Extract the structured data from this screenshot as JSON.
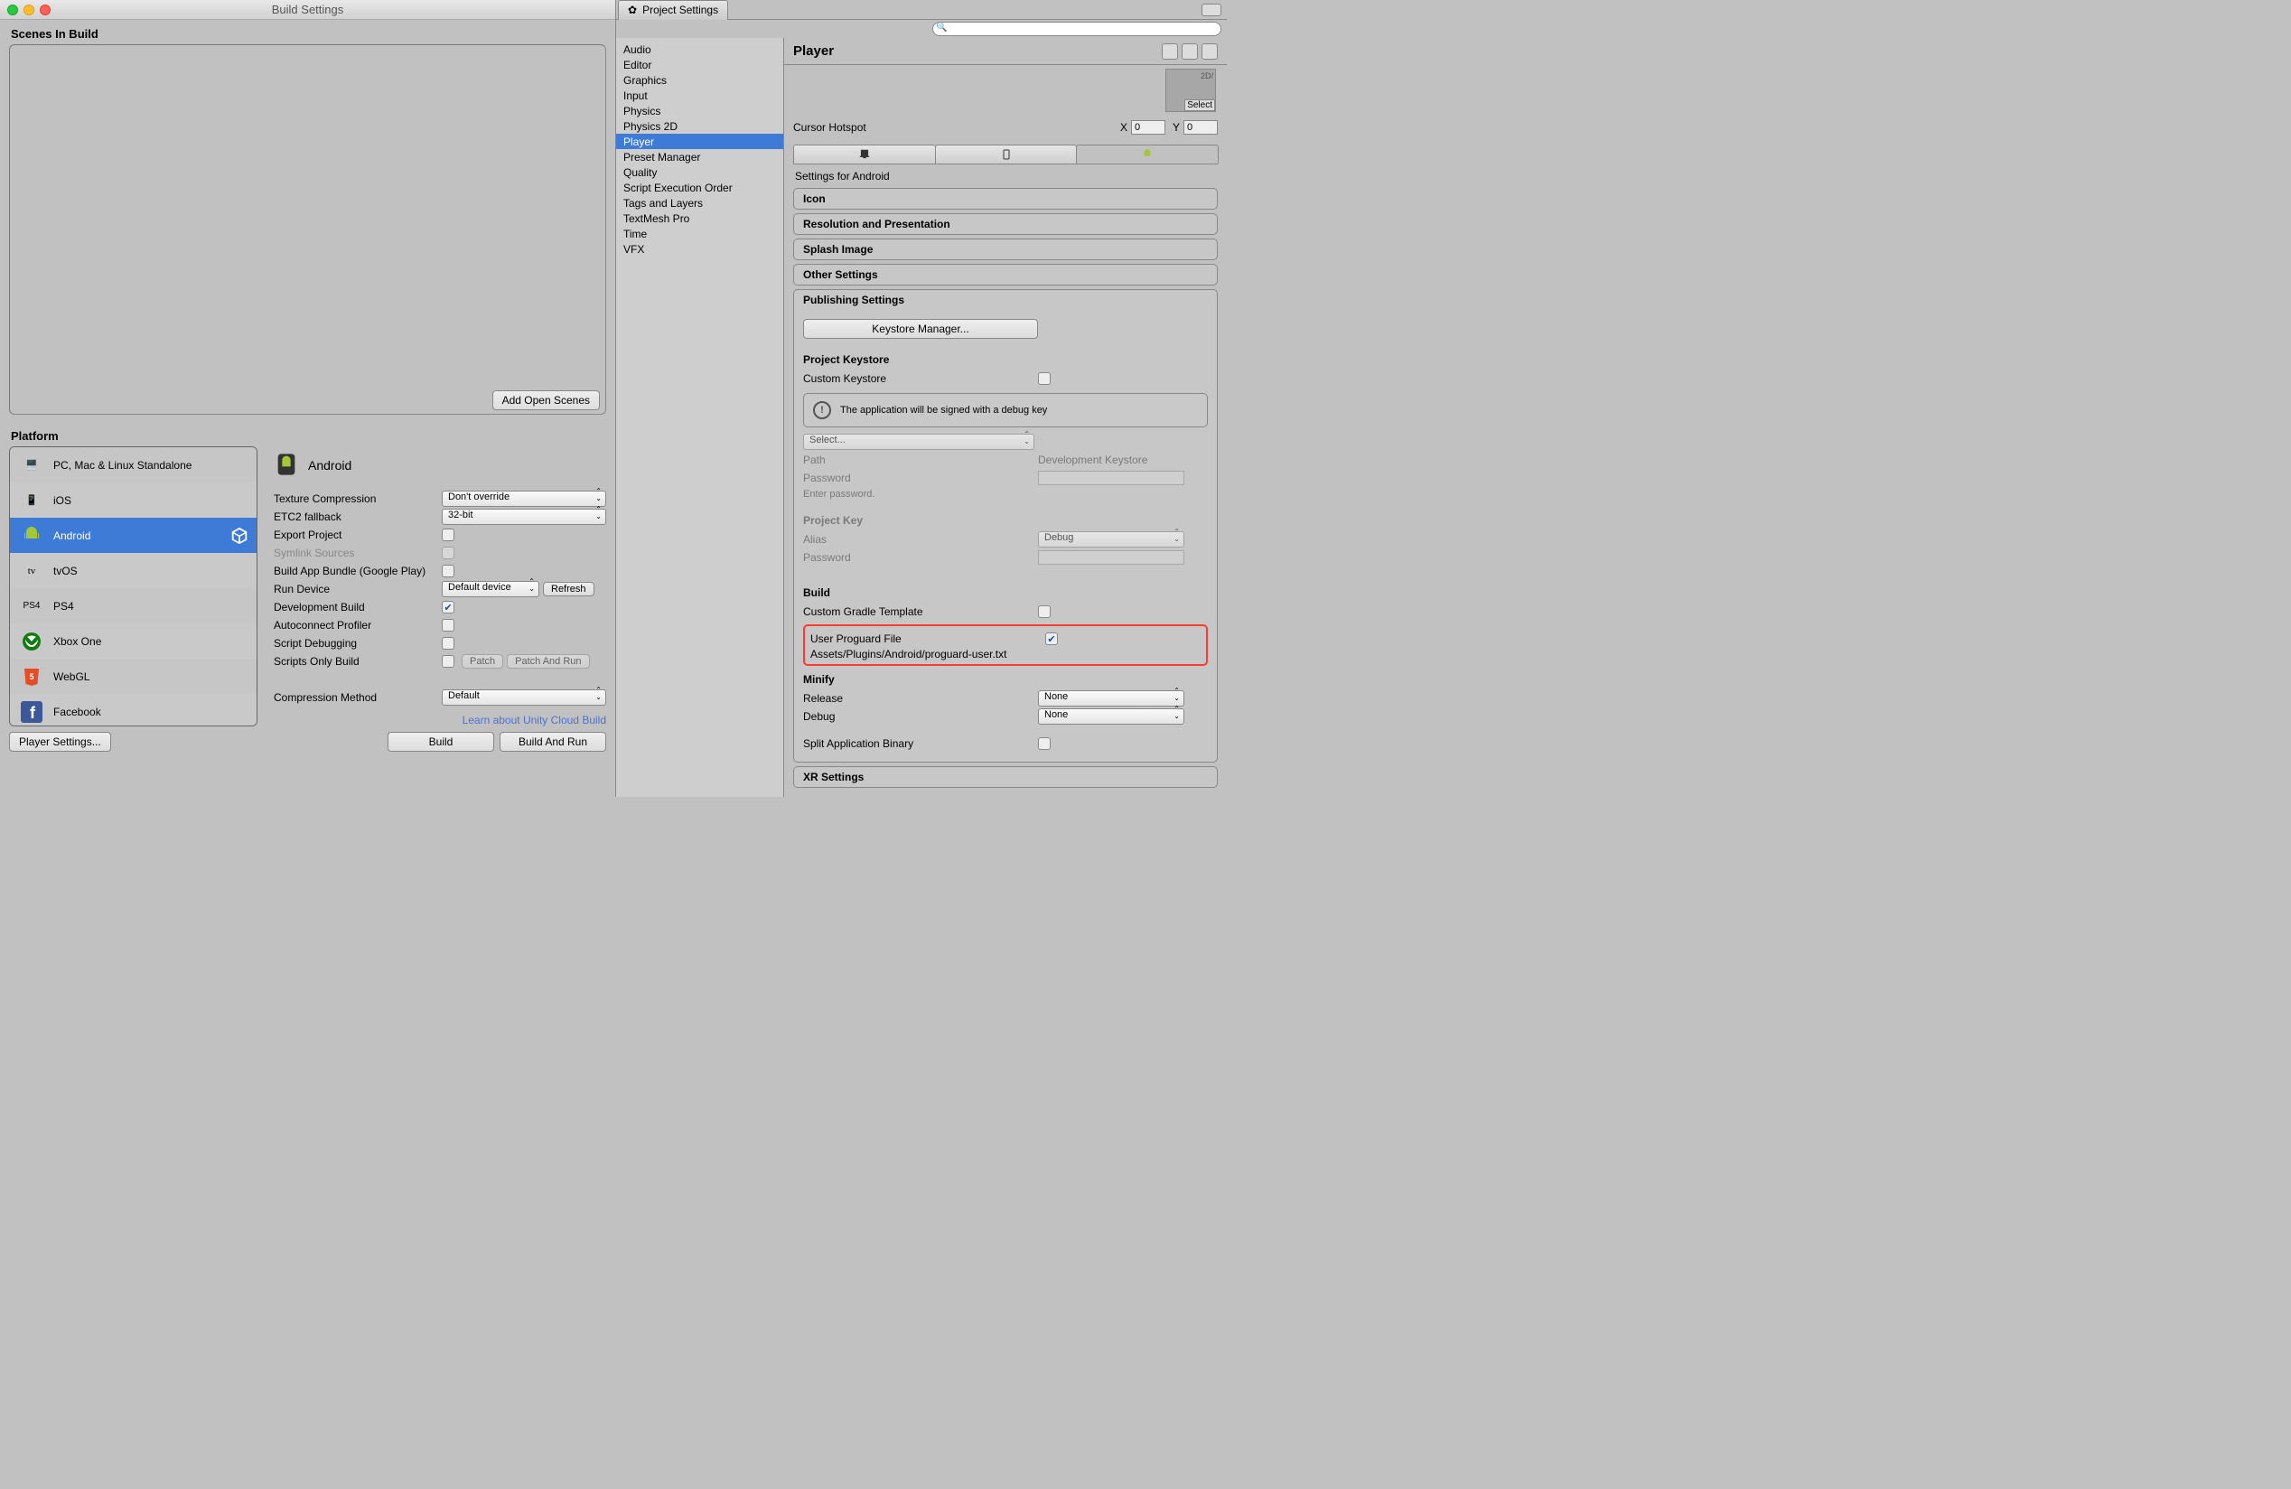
{
  "buildWindow": {
    "title": "Build Settings",
    "scenesLabel": "Scenes In Build",
    "addOpenScenes": "Add Open Scenes",
    "platformLabel": "Platform",
    "platforms": [
      "PC, Mac & Linux Standalone",
      "iOS",
      "Android",
      "tvOS",
      "PS4",
      "Xbox One",
      "WebGL",
      "Facebook"
    ],
    "selectedPlatform": "Android",
    "options": {
      "textureCompression": {
        "label": "Texture Compression",
        "value": "Don't override"
      },
      "etc2": {
        "label": "ETC2 fallback",
        "value": "32-bit"
      },
      "exportProject": "Export Project",
      "symlink": "Symlink Sources",
      "bundle": "Build App Bundle (Google Play)",
      "runDevice": {
        "label": "Run Device",
        "value": "Default device",
        "refresh": "Refresh"
      },
      "devBuild": "Development Build",
      "autoconnect": "Autoconnect Profiler",
      "scriptDebug": "Script Debugging",
      "scriptsOnly": "Scripts Only Build",
      "patch": "Patch",
      "patchRun": "Patch And Run",
      "compressionMethod": {
        "label": "Compression Method",
        "value": "Default"
      }
    },
    "cloudLink": "Learn about Unity Cloud Build",
    "playerSettingsBtn": "Player Settings...",
    "build": "Build",
    "buildRun": "Build And Run"
  },
  "ps": {
    "tabTitle": "Project Settings",
    "categories": [
      "Audio",
      "Editor",
      "Graphics",
      "Input",
      "Physics",
      "Physics 2D",
      "Player",
      "Preset Manager",
      "Quality",
      "Script Execution Order",
      "Tags and Layers",
      "TextMesh Pro",
      "Time",
      "VFX"
    ],
    "selectedCategory": "Player",
    "detailTitle": "Player",
    "thumbLabel": "2D/",
    "thumbSelect": "Select",
    "cursorHotspot": "Cursor Hotspot",
    "xLabel": "X",
    "xVal": "0",
    "yLabel": "Y",
    "yVal": "0",
    "settingsFor": "Settings for Android",
    "foldouts": {
      "icon": "Icon",
      "resPres": "Resolution and Presentation",
      "splash": "Splash Image",
      "other": "Other Settings",
      "publishing": "Publishing Settings",
      "xr": "XR Settings"
    },
    "publishing": {
      "keystoreMgr": "Keystore Manager...",
      "projKeystore": "Project Keystore",
      "customKeystore": "Custom Keystore",
      "infoMsg": "The application will be signed with a debug key",
      "selectDrop": "Select...",
      "path": "Path",
      "pathVal": "Development Keystore",
      "password": "Password",
      "enterPw": "Enter password.",
      "projKey": "Project Key",
      "alias": "Alias",
      "aliasVal": "Debug",
      "build": "Build",
      "customGradle": "Custom Gradle Template",
      "userProguard": "User Proguard File",
      "proguardPath": "Assets/Plugins/Android/proguard-user.txt",
      "minify": "Minify",
      "release": "Release",
      "releaseVal": "None",
      "debug": "Debug",
      "debugVal": "None",
      "splitBinary": "Split Application Binary"
    }
  }
}
